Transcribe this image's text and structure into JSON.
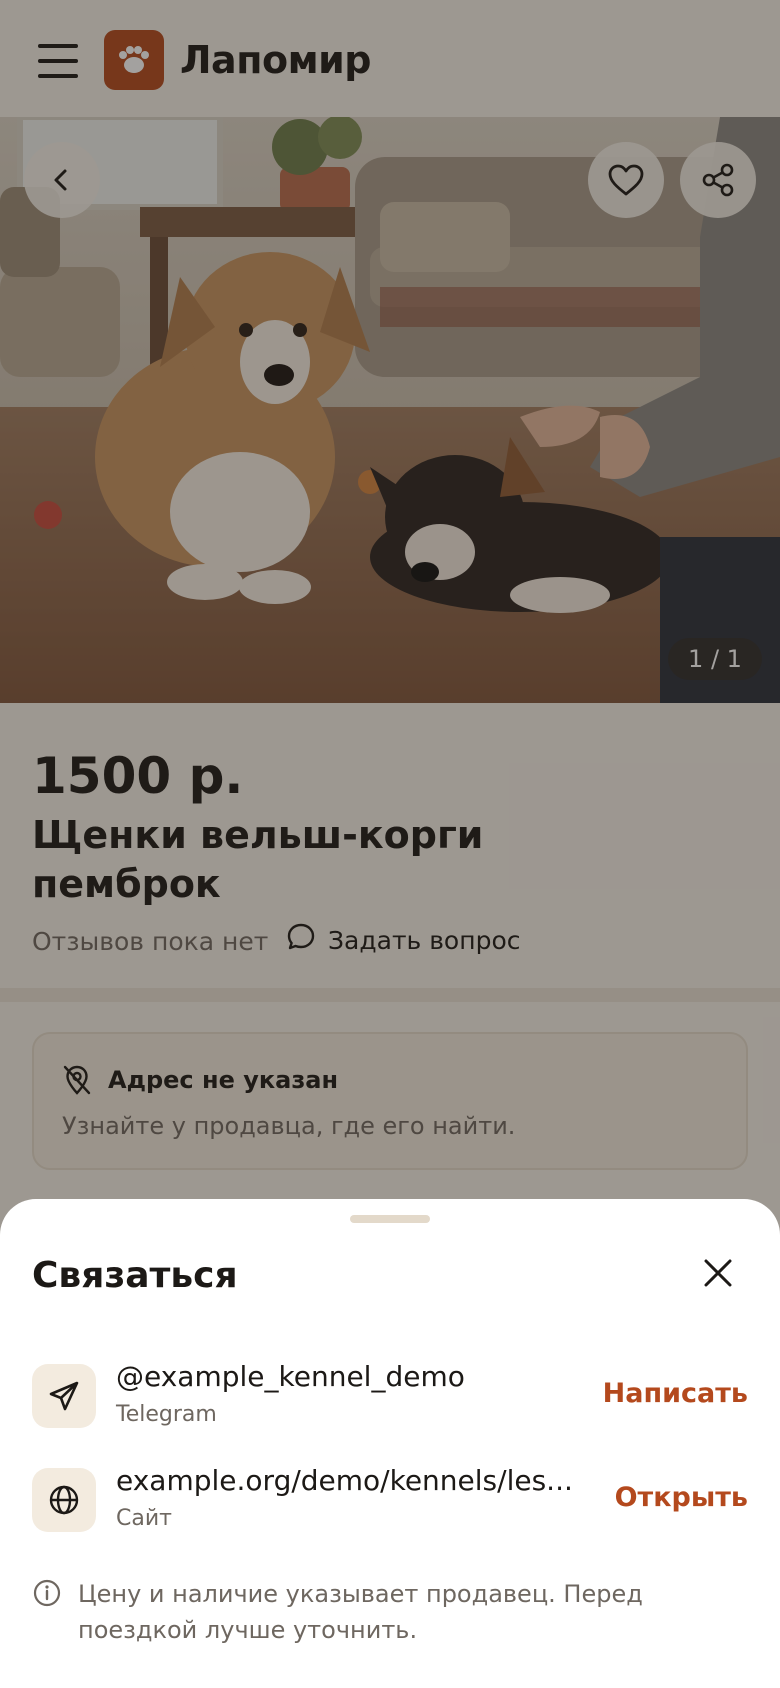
{
  "header": {
    "logo_text": "Лапомир",
    "menu_icon": "hamburger-menu-icon",
    "logo_icon": "paw-icon"
  },
  "photo": {
    "counter": "1 / 1",
    "back_icon": "chevron-left-icon",
    "favorite_icon": "heart-icon",
    "share_icon": "share-icon"
  },
  "listing": {
    "price": "1500 р.",
    "title": "Щенки вельш-корги пемброк",
    "reviews_text": "Отзывов пока нет",
    "ask_label": "Задать вопрос"
  },
  "address": {
    "title": "Адрес не указан",
    "subtitle": "Узнайте у продавца, где его найти."
  },
  "contact_sheet": {
    "title": "Связаться",
    "contacts": [
      {
        "value": "@example_kennel_demo",
        "type": "Telegram",
        "action": "Написать",
        "icon": "paper-plane-icon"
      },
      {
        "value": "example.org/demo/kennels/les...",
        "type": "Сайт",
        "action": "Открыть",
        "icon": "globe-icon"
      }
    ],
    "note": "Цену и наличие указывает продавец. Перед поездкой лучше уточнить."
  },
  "colors": {
    "accent": "#b4491d",
    "background": "#f4efe7",
    "text": "#1c1916",
    "muted": "#6e6760"
  }
}
